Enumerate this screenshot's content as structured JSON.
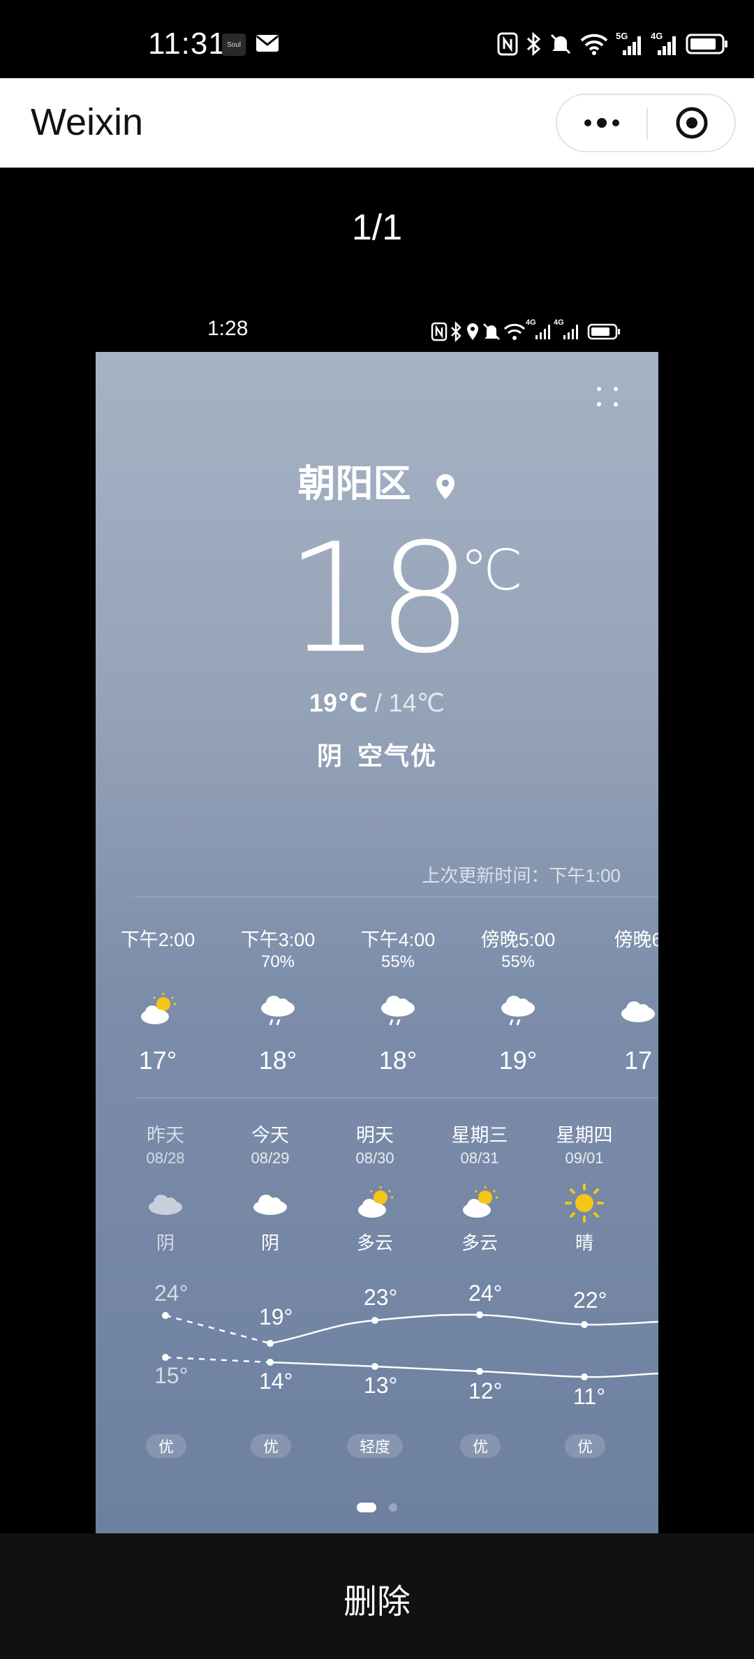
{
  "status_bar": {
    "time": "11:31",
    "soul_label": "Soul",
    "right_icons": [
      "nfc-icon",
      "bluetooth-icon",
      "mute-icon",
      "wifi-icon",
      "5g-signal-icon",
      "4g-signal-icon",
      "battery-icon"
    ],
    "net1": "5G",
    "net2": "4G"
  },
  "title_bar": {
    "title": "Weixin"
  },
  "viewer": {
    "counter": "1/1",
    "delete_label": "删除"
  },
  "inner_status": {
    "time": "1:28",
    "net1": "4G",
    "net2": "4G"
  },
  "weather": {
    "location": "朝阳区",
    "temperature": "18",
    "unit": "℃",
    "range_high": "19℃",
    "range_sep": " / ",
    "range_low": "14℃",
    "condition": "阴",
    "air": "空气优",
    "update_time": "上次更新时间：下午1:00",
    "hourly": [
      {
        "time": "下午2:00",
        "precip": "",
        "icon": "partly-sunny-icon",
        "temp": "17°"
      },
      {
        "time": "下午3:00",
        "precip": "70%",
        "icon": "rain-cloud-icon",
        "temp": "18°"
      },
      {
        "time": "下午4:00",
        "precip": "55%",
        "icon": "rain-cloud-icon",
        "temp": "18°"
      },
      {
        "time": "傍晚5:00",
        "precip": "55%",
        "icon": "rain-cloud-icon",
        "temp": "19°"
      },
      {
        "time": "傍晚6",
        "precip": "",
        "icon": "cloud-icon",
        "temp": "17"
      }
    ],
    "daily": [
      {
        "day": "昨天",
        "date": "08/28",
        "icon": "cloud-icon",
        "cond": "阴",
        "high": "24°",
        "low": "15°",
        "aqi": "优"
      },
      {
        "day": "今天",
        "date": "08/29",
        "icon": "cloud-icon",
        "cond": "阴",
        "high": "19°",
        "low": "14°",
        "aqi": "优"
      },
      {
        "day": "明天",
        "date": "08/30",
        "icon": "partly-sunny-icon",
        "cond": "多云",
        "high": "23°",
        "low": "13°",
        "aqi": "轻度"
      },
      {
        "day": "星期三",
        "date": "08/31",
        "icon": "partly-sunny-icon",
        "cond": "多云",
        "high": "24°",
        "low": "12°",
        "aqi": "优"
      },
      {
        "day": "星期四",
        "date": "09/01",
        "icon": "sun-icon",
        "cond": "晴",
        "high": "22°",
        "low": "11°",
        "aqi": "优"
      }
    ],
    "colors": {
      "sun": "#f5c518",
      "cloud": "#ffffff",
      "cloud_muted": "#c8d0dc"
    }
  }
}
